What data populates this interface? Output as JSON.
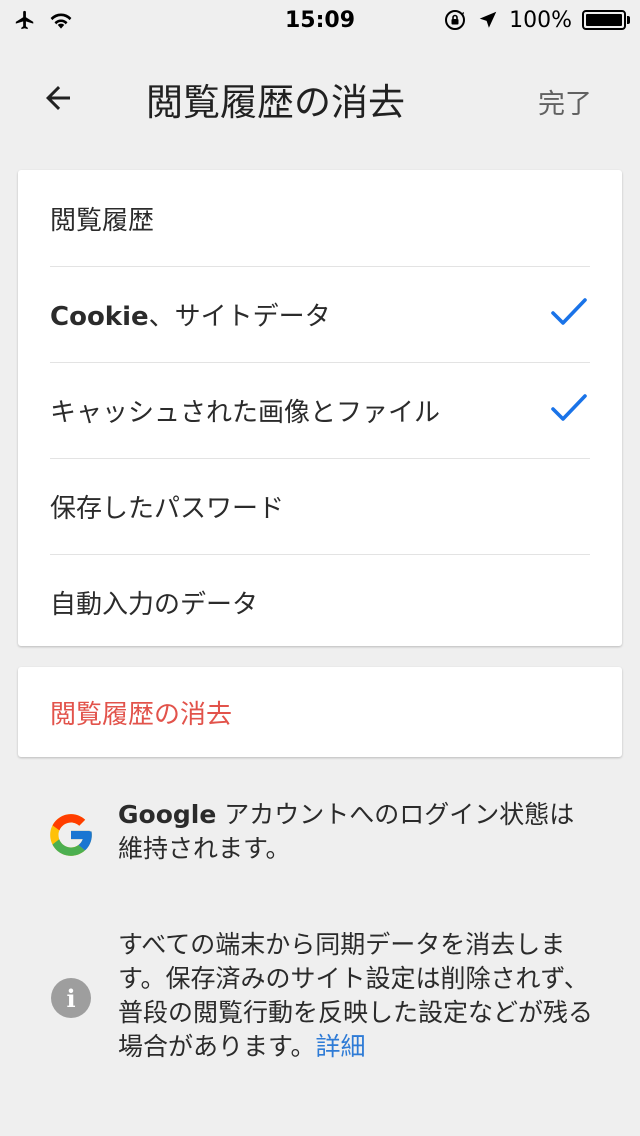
{
  "status_bar": {
    "time": "15:09",
    "battery_text": "100%",
    "battery_level": 1.0,
    "icons": [
      "airplane-icon",
      "wifi-icon",
      "rotation-lock-icon",
      "location-arrow-icon",
      "battery-icon"
    ]
  },
  "nav": {
    "title": "閲覧履歴の消去",
    "done_label": "完了",
    "back_icon": "arrow-left-icon"
  },
  "options": {
    "items": [
      {
        "label_bold": "",
        "label": "閲覧履歴",
        "checked": false
      },
      {
        "label_bold": "Cookie",
        "label": "、サイトデータ",
        "checked": true
      },
      {
        "label_bold": "",
        "label": "キャッシュされた画像とファイル",
        "checked": true
      },
      {
        "label_bold": "",
        "label": "保存したパスワード",
        "checked": false
      },
      {
        "label_bold": "",
        "label": "自動入力のデータ",
        "checked": false
      }
    ]
  },
  "clear": {
    "label": "閲覧履歴の消去"
  },
  "google_notice": {
    "bold": "Google",
    "text": " アカウントへのログイン状態は維持されます。"
  },
  "sync_notice": {
    "text": "すべての端末から同期データを消去します。保存済みのサイト設定は削除されず、普段の閲覧行動を反映した設定などが残る場合があります。",
    "link": "詳細"
  },
  "colors": {
    "accent": "#1a73e8",
    "danger": "#e2534b",
    "link": "#2e7bd6",
    "background": "#efefef"
  }
}
